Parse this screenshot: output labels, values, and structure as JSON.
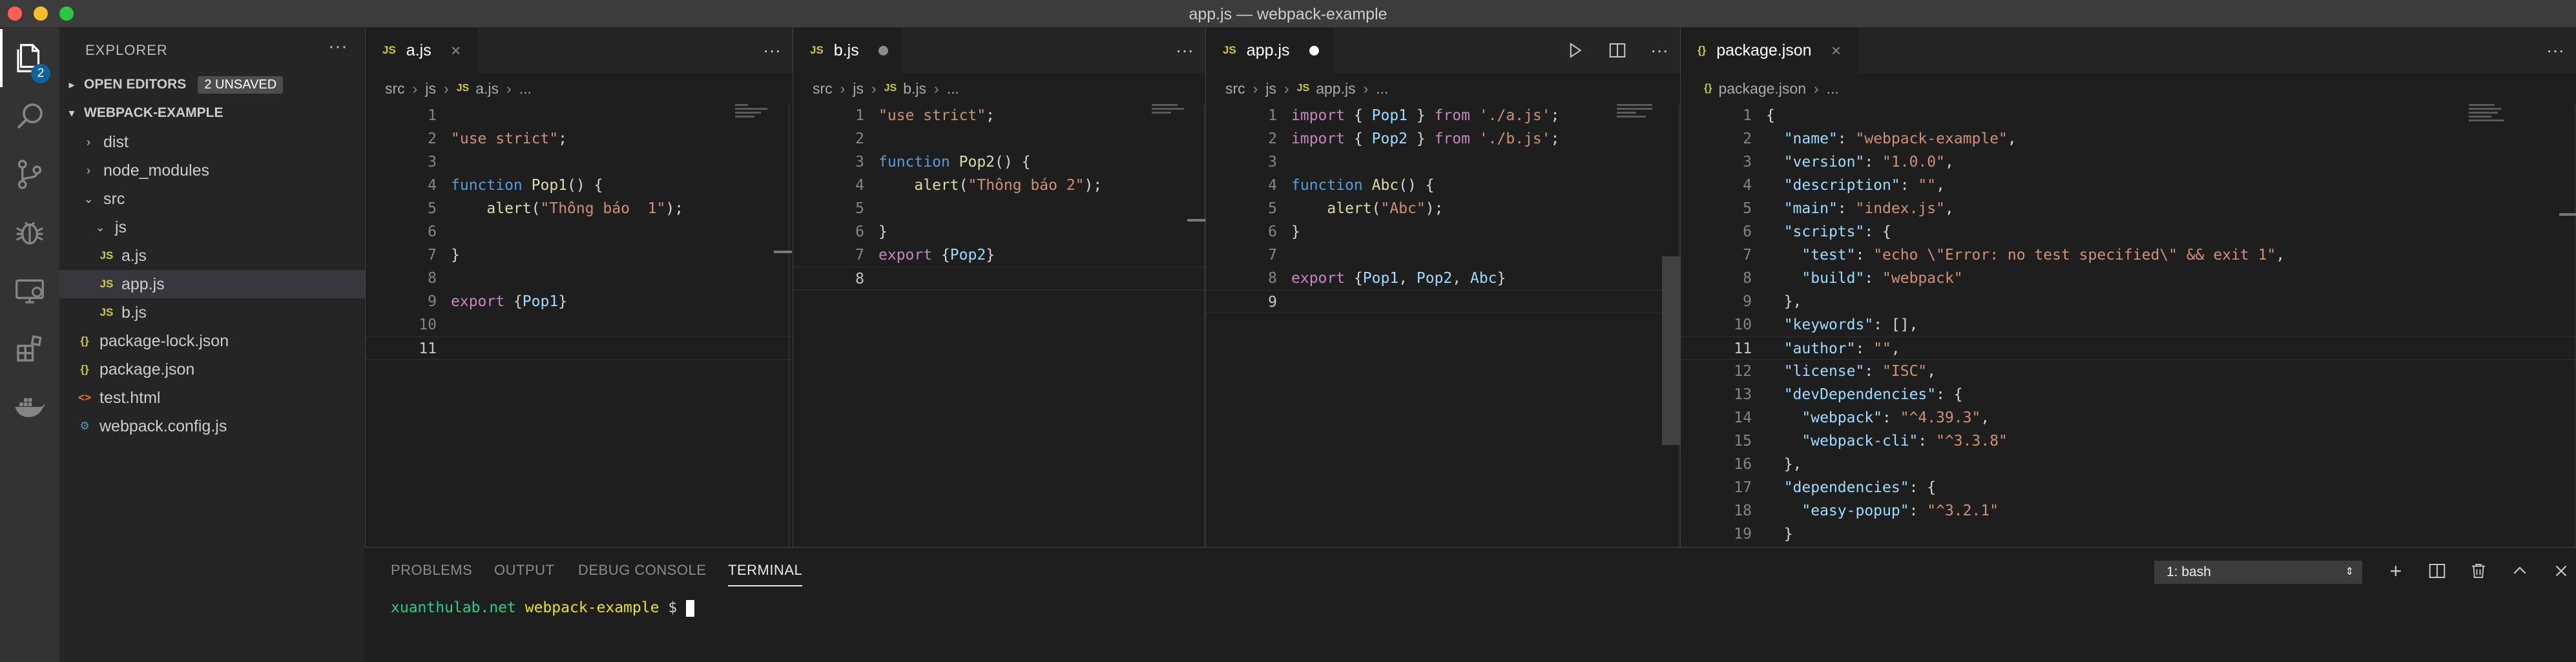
{
  "window": {
    "title": "app.js — webpack-example"
  },
  "activity_bar": {
    "explorer_badge": "2"
  },
  "explorer": {
    "header": "EXPLORER",
    "open_editors": {
      "label": "OPEN EDITORS",
      "badge": "2 UNSAVED"
    },
    "project": {
      "label": "WEBPACK-EXAMPLE"
    },
    "items": [
      {
        "label": "dist",
        "type": "folder",
        "expanded": false
      },
      {
        "label": "node_modules",
        "type": "folder",
        "expanded": false
      },
      {
        "label": "src",
        "type": "folder",
        "expanded": true
      },
      {
        "label": "js",
        "type": "folder",
        "expanded": true
      },
      {
        "label": "a.js",
        "type": "js",
        "icon": "JS"
      },
      {
        "label": "app.js",
        "type": "js",
        "icon": "JS",
        "selected": true
      },
      {
        "label": "b.js",
        "type": "js",
        "icon": "JS"
      },
      {
        "label": "package-lock.json",
        "type": "json",
        "icon": "{}"
      },
      {
        "label": "package.json",
        "type": "json",
        "icon": "{}"
      },
      {
        "label": "test.html",
        "type": "html",
        "icon": "<>"
      },
      {
        "label": "webpack.config.js",
        "type": "config",
        "icon": "⚙"
      }
    ]
  },
  "editors": [
    {
      "tab": {
        "label": "a.js",
        "icon": "JS",
        "state": "clean"
      },
      "breadcrumb": [
        "src",
        "js",
        "a.js",
        "..."
      ],
      "current_line": 11,
      "lines": [
        {
          "n": "1",
          "t": []
        },
        {
          "n": "2",
          "t": [
            [
              "s",
              "\"use strict\""
            ],
            [
              "p",
              ";"
            ]
          ]
        },
        {
          "n": "3",
          "t": []
        },
        {
          "n": "4",
          "t": [
            [
              "kb",
              "function"
            ],
            [
              "p",
              " "
            ],
            [
              "f",
              "Pop1"
            ],
            [
              "p",
              "() {"
            ]
          ]
        },
        {
          "n": "5",
          "t": [
            [
              "p",
              "    "
            ],
            [
              "f",
              "alert"
            ],
            [
              "p",
              "("
            ],
            [
              "s",
              "\"Thông báo  1\""
            ],
            [
              "p",
              ");"
            ]
          ]
        },
        {
          "n": "6",
          "t": []
        },
        {
          "n": "7",
          "t": [
            [
              "p",
              "}"
            ]
          ]
        },
        {
          "n": "8",
          "t": []
        },
        {
          "n": "9",
          "t": [
            [
              "k",
              "export"
            ],
            [
              "p",
              " {"
            ],
            [
              "v",
              "Pop1"
            ],
            [
              "p",
              "}"
            ]
          ]
        },
        {
          "n": "10",
          "t": []
        },
        {
          "n": "11",
          "t": []
        }
      ]
    },
    {
      "tab": {
        "label": "b.js",
        "icon": "JS",
        "state": "dirty"
      },
      "breadcrumb": [
        "src",
        "js",
        "b.js",
        "..."
      ],
      "current_line": 8,
      "lines": [
        {
          "n": "1",
          "t": [
            [
              "s",
              "\"use strict\""
            ],
            [
              "p",
              ";"
            ]
          ]
        },
        {
          "n": "2",
          "t": []
        },
        {
          "n": "3",
          "t": [
            [
              "kb",
              "function"
            ],
            [
              "p",
              " "
            ],
            [
              "f",
              "Pop2"
            ],
            [
              "p",
              "() {"
            ]
          ]
        },
        {
          "n": "4",
          "t": [
            [
              "p",
              "    "
            ],
            [
              "f",
              "alert"
            ],
            [
              "p",
              "("
            ],
            [
              "s",
              "\"Thông báo 2\""
            ],
            [
              "p",
              ");"
            ]
          ]
        },
        {
          "n": "5",
          "t": []
        },
        {
          "n": "6",
          "t": [
            [
              "p",
              "}"
            ]
          ]
        },
        {
          "n": "7",
          "t": [
            [
              "k",
              "export"
            ],
            [
              "p",
              " {"
            ],
            [
              "v",
              "Pop2"
            ],
            [
              "p",
              "}"
            ]
          ]
        },
        {
          "n": "8",
          "t": []
        }
      ]
    },
    {
      "tab": {
        "label": "app.js",
        "icon": "JS",
        "state": "dirty"
      },
      "breadcrumb": [
        "src",
        "js",
        "app.js",
        "..."
      ],
      "current_line": 9,
      "lines": [
        {
          "n": "1",
          "t": [
            [
              "k",
              "import"
            ],
            [
              "p",
              " { "
            ],
            [
              "v",
              "Pop1"
            ],
            [
              "p",
              " } "
            ],
            [
              "k",
              "from"
            ],
            [
              "p",
              " "
            ],
            [
              "s",
              "'./a.js'"
            ],
            [
              "p",
              ";"
            ]
          ]
        },
        {
          "n": "2",
          "t": [
            [
              "k",
              "import"
            ],
            [
              "p",
              " { "
            ],
            [
              "v",
              "Pop2"
            ],
            [
              "p",
              " } "
            ],
            [
              "k",
              "from"
            ],
            [
              "p",
              " "
            ],
            [
              "s",
              "'./b.js'"
            ],
            [
              "p",
              ";"
            ]
          ]
        },
        {
          "n": "3",
          "t": []
        },
        {
          "n": "4",
          "t": [
            [
              "kb",
              "function"
            ],
            [
              "p",
              " "
            ],
            [
              "f",
              "Abc"
            ],
            [
              "p",
              "() {"
            ]
          ]
        },
        {
          "n": "5",
          "t": [
            [
              "p",
              "    "
            ],
            [
              "f",
              "alert"
            ],
            [
              "p",
              "("
            ],
            [
              "s",
              "\"Abc\""
            ],
            [
              "p",
              ");"
            ]
          ]
        },
        {
          "n": "6",
          "t": [
            [
              "p",
              "}"
            ]
          ]
        },
        {
          "n": "7",
          "t": []
        },
        {
          "n": "8",
          "t": [
            [
              "k",
              "export"
            ],
            [
              "p",
              " {"
            ],
            [
              "v",
              "Pop1"
            ],
            [
              "p",
              ", "
            ],
            [
              "v",
              "Pop2"
            ],
            [
              "p",
              ", "
            ],
            [
              "v",
              "Abc"
            ],
            [
              "p",
              "}"
            ]
          ]
        },
        {
          "n": "9",
          "t": []
        }
      ]
    },
    {
      "tab": {
        "label": "package.json",
        "icon": "{}",
        "state": "clean"
      },
      "breadcrumb": [
        "package.json",
        "..."
      ],
      "current_line": 11,
      "lines": [
        {
          "n": "1",
          "t": [
            [
              "p",
              "{"
            ]
          ]
        },
        {
          "n": "2",
          "t": [
            [
              "p",
              "  "
            ],
            [
              "jk",
              "\"name\""
            ],
            [
              "p",
              ": "
            ],
            [
              "js",
              "\"webpack-example\""
            ],
            [
              "p",
              ","
            ]
          ]
        },
        {
          "n": "3",
          "t": [
            [
              "p",
              "  "
            ],
            [
              "jk",
              "\"version\""
            ],
            [
              "p",
              ": "
            ],
            [
              "js",
              "\"1.0.0\""
            ],
            [
              "p",
              ","
            ]
          ]
        },
        {
          "n": "4",
          "t": [
            [
              "p",
              "  "
            ],
            [
              "jk",
              "\"description\""
            ],
            [
              "p",
              ": "
            ],
            [
              "js",
              "\"\""
            ],
            [
              "p",
              ","
            ]
          ]
        },
        {
          "n": "5",
          "t": [
            [
              "p",
              "  "
            ],
            [
              "jk",
              "\"main\""
            ],
            [
              "p",
              ": "
            ],
            [
              "js",
              "\"index.js\""
            ],
            [
              "p",
              ","
            ]
          ]
        },
        {
          "n": "6",
          "t": [
            [
              "p",
              "  "
            ],
            [
              "jk",
              "\"scripts\""
            ],
            [
              "p",
              ": {"
            ]
          ]
        },
        {
          "n": "7",
          "t": [
            [
              "p",
              "    "
            ],
            [
              "jk",
              "\"test\""
            ],
            [
              "p",
              ": "
            ],
            [
              "js",
              "\"echo \\\"Error: no test specified\\\" && exit 1\""
            ],
            [
              "p",
              ","
            ]
          ]
        },
        {
          "n": "8",
          "t": [
            [
              "p",
              "    "
            ],
            [
              "jk",
              "\"build\""
            ],
            [
              "p",
              ": "
            ],
            [
              "js",
              "\"webpack\""
            ]
          ]
        },
        {
          "n": "9",
          "t": [
            [
              "p",
              "  },"
            ]
          ]
        },
        {
          "n": "10",
          "t": [
            [
              "p",
              "  "
            ],
            [
              "jk",
              "\"keywords\""
            ],
            [
              "p",
              ": [],"
            ]
          ]
        },
        {
          "n": "11",
          "t": [
            [
              "p",
              "  "
            ],
            [
              "jk",
              "\"author\""
            ],
            [
              "p",
              ": "
            ],
            [
              "js",
              "\"\""
            ],
            [
              "p",
              ","
            ]
          ]
        },
        {
          "n": "12",
          "t": [
            [
              "p",
              "  "
            ],
            [
              "jk",
              "\"license\""
            ],
            [
              "p",
              ": "
            ],
            [
              "js",
              "\"ISC\""
            ],
            [
              "p",
              ","
            ]
          ]
        },
        {
          "n": "13",
          "t": [
            [
              "p",
              "  "
            ],
            [
              "jk",
              "\"devDependencies\""
            ],
            [
              "p",
              ": {"
            ]
          ]
        },
        {
          "n": "14",
          "t": [
            [
              "p",
              "    "
            ],
            [
              "jk",
              "\"webpack\""
            ],
            [
              "p",
              ": "
            ],
            [
              "js",
              "\"^4.39.3\""
            ],
            [
              "p",
              ","
            ]
          ]
        },
        {
          "n": "15",
          "t": [
            [
              "p",
              "    "
            ],
            [
              "jk",
              "\"webpack-cli\""
            ],
            [
              "p",
              ": "
            ],
            [
              "js",
              "\"^3.3.8\""
            ]
          ]
        },
        {
          "n": "16",
          "t": [
            [
              "p",
              "  },"
            ]
          ]
        },
        {
          "n": "17",
          "t": [
            [
              "p",
              "  "
            ],
            [
              "jk",
              "\"dependencies\""
            ],
            [
              "p",
              ": {"
            ]
          ]
        },
        {
          "n": "18",
          "t": [
            [
              "p",
              "    "
            ],
            [
              "jk",
              "\"easy-popup\""
            ],
            [
              "p",
              ": "
            ],
            [
              "js",
              "\"^3.2.1\""
            ]
          ]
        },
        {
          "n": "19",
          "t": [
            [
              "p",
              "  }"
            ]
          ]
        }
      ]
    }
  ],
  "panel": {
    "tabs": [
      "PROBLEMS",
      "OUTPUT",
      "DEBUG CONSOLE",
      "TERMINAL"
    ],
    "active_tab": "TERMINAL",
    "terminal_select": "1: bash",
    "prompt": {
      "host": "xuanthulab.net",
      "dir": "webpack-example",
      "symbol": "$"
    }
  },
  "colors": {
    "accent": "#0e639c",
    "keyword": "#c586c0",
    "storage": "#569cd6",
    "string": "#ce9178",
    "function": "#dcdcaa",
    "variable": "#9cdcfe",
    "terminal_host": "#23d18b",
    "terminal_dir": "#e5e510"
  }
}
